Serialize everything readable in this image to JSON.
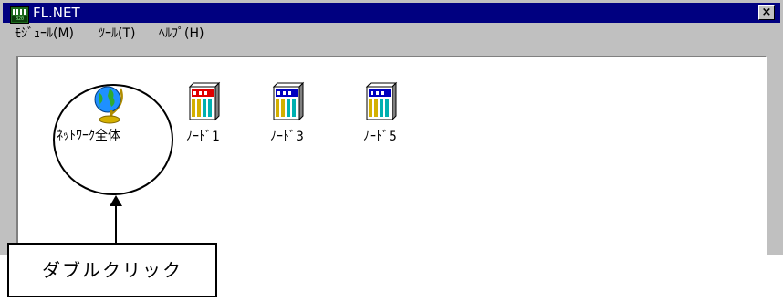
{
  "window": {
    "title": "FL.NET",
    "app_icon_tag": "B20",
    "close_label": "×"
  },
  "menubar": {
    "items": [
      {
        "label": "ﾓｼﾞｭｰﾙ(M)"
      },
      {
        "label": "ﾂｰﾙ(T)"
      },
      {
        "label": "ﾍﾙﾌﾟ(H)"
      }
    ]
  },
  "icons": [
    {
      "label": "ﾈｯﾄﾜｰｸ全体",
      "icon": "globe-icon"
    },
    {
      "label": "ﾉｰﾄﾞ1",
      "icon": "plc-rack-icon-red"
    },
    {
      "label": "ﾉｰﾄﾞ3",
      "icon": "plc-rack-icon-blue"
    },
    {
      "label": "ﾉｰﾄﾞ5",
      "icon": "plc-rack-icon-blue"
    }
  ],
  "annotation": {
    "label": "ダブルクリック"
  },
  "colors": {
    "titlebar": "#000080",
    "window": "#c0c0c0",
    "rack_red": "#e00000",
    "rack_blue": "#0000c0",
    "globe": "#1e90ff",
    "stand": "#d4b000"
  }
}
